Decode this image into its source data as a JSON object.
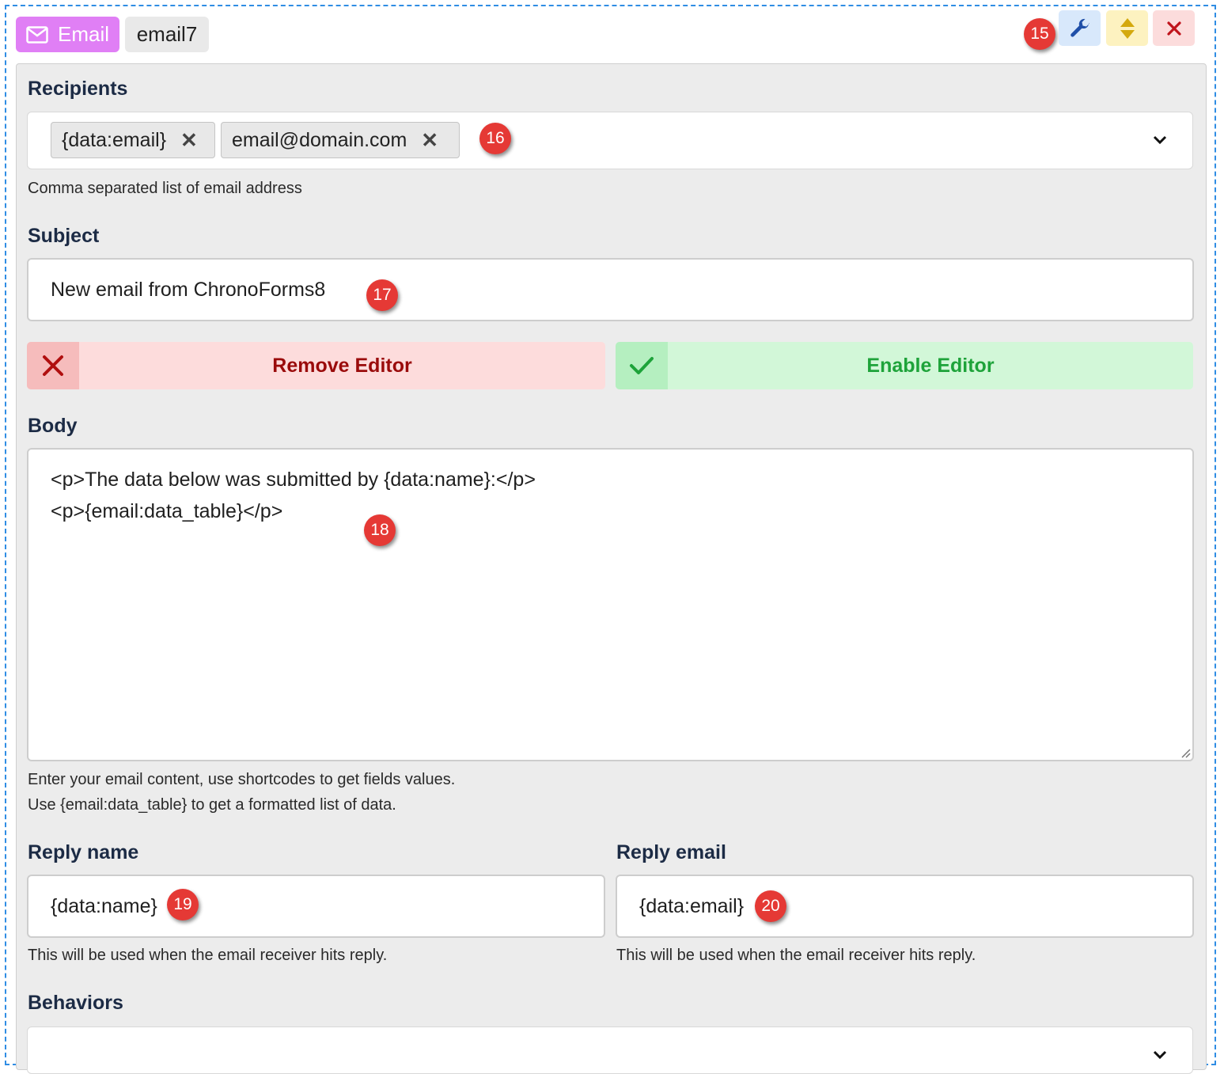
{
  "header": {
    "type_label": "Email",
    "block_name": "email7",
    "badge": "15"
  },
  "recipients": {
    "label": "Recipients",
    "chips": [
      "{data:email}",
      "email@domain.com"
    ],
    "badge": "16",
    "help": "Comma separated list of email address"
  },
  "subject": {
    "label": "Subject",
    "value": "New email from ChronoForms8",
    "badge": "17"
  },
  "editor_buttons": {
    "remove_label": "Remove Editor",
    "enable_label": "Enable Editor"
  },
  "body": {
    "label": "Body",
    "lines": [
      "<p>The data below was submitted by {data:name}:</p>",
      "<p>{email:data_table}</p>"
    ],
    "badge": "18",
    "help_line1": "Enter your email content, use shortcodes to get fields values.",
    "help_line2": "Use {email:data_table} to get a formatted list of data."
  },
  "reply_name": {
    "label": "Reply name",
    "value": "{data:name}",
    "badge": "19",
    "help": "This will be used when the email receiver hits reply."
  },
  "reply_email": {
    "label": "Reply email",
    "value": "{data:email}",
    "badge": "20",
    "help": "This will be used when the email receiver hits reply."
  },
  "behaviors": {
    "label": "Behaviors"
  },
  "colors": {
    "type_tag": "#e07ff5",
    "badge": "#e53935",
    "remove": "#9a0b0b",
    "enable": "#1ea33a",
    "border_dashed": "#2f8de4"
  }
}
